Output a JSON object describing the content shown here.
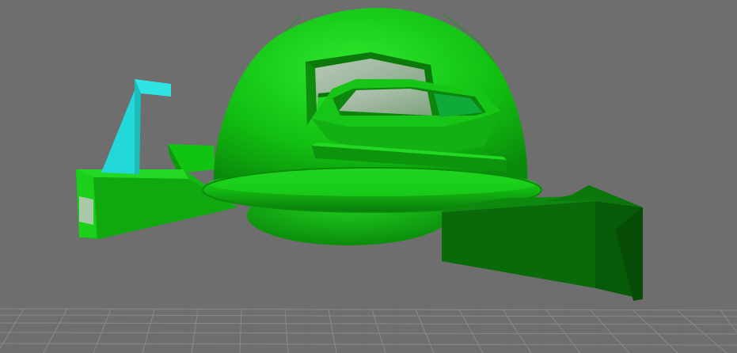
{
  "viewport": {
    "background_color": "#6e6e6e",
    "grid_color": "#8a8a8a",
    "model_colors": {
      "bright_green": "#1fd01f",
      "mid_green": "#12b012",
      "dark_green": "#0a6a0a",
      "shadow_green": "#075207",
      "cyan": "#22d8d8",
      "glass": "#9cb79c"
    }
  }
}
